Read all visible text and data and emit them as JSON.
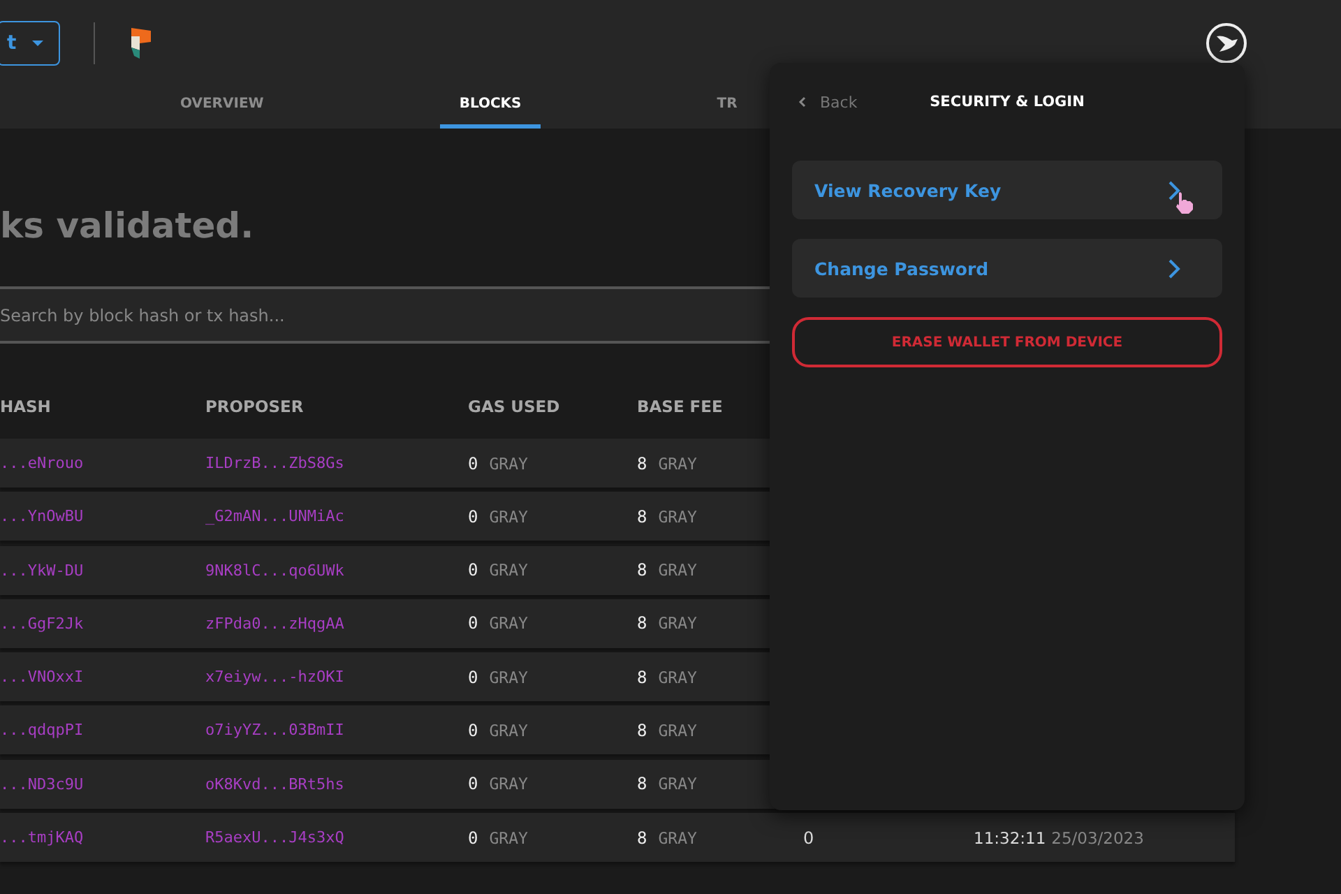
{
  "header": {
    "network_button": {
      "label": "t"
    },
    "tabs": [
      {
        "label": "OVERVIEW",
        "selected": false
      },
      {
        "label": "BLOCKS",
        "selected": true
      },
      {
        "label": "TR",
        "selected": false
      }
    ]
  },
  "heading": "ks validated.",
  "search": {
    "placeholder": "Search by block hash or tx hash..."
  },
  "table": {
    "columns": [
      "HASH",
      "PROPOSER",
      "GAS USED",
      "BASE FEE"
    ],
    "rows": [
      {
        "hash": "...eNrouo",
        "proposer": "ILDrzB...ZbS8Gs",
        "gas_used": "0",
        "gas_unit": "GRAY",
        "base_fee": "8",
        "fee_unit": "GRAY"
      },
      {
        "hash": "...YnOwBU",
        "proposer": "_G2mAN...UNMiAc",
        "gas_used": "0",
        "gas_unit": "GRAY",
        "base_fee": "8",
        "fee_unit": "GRAY"
      },
      {
        "hash": "...YkW-DU",
        "proposer": "9NK8lC...qo6UWk",
        "gas_used": "0",
        "gas_unit": "GRAY",
        "base_fee": "8",
        "fee_unit": "GRAY"
      },
      {
        "hash": "...GgF2Jk",
        "proposer": "zFPda0...zHqgAA",
        "gas_used": "0",
        "gas_unit": "GRAY",
        "base_fee": "8",
        "fee_unit": "GRAY"
      },
      {
        "hash": "...VNOxxI",
        "proposer": "x7eiyw...-hzOKI",
        "gas_used": "0",
        "gas_unit": "GRAY",
        "base_fee": "8",
        "fee_unit": "GRAY"
      },
      {
        "hash": "...qdqpPI",
        "proposer": "o7iyYZ...03BmII",
        "gas_used": "0",
        "gas_unit": "GRAY",
        "base_fee": "8",
        "fee_unit": "GRAY"
      },
      {
        "hash": "...ND3c9U",
        "proposer": "oK8Kvd...BRt5hs",
        "gas_used": "0",
        "gas_unit": "GRAY",
        "base_fee": "8",
        "fee_unit": "GRAY"
      },
      {
        "hash": "...tmjKAQ",
        "proposer": "R5aexU...J4s3xQ",
        "gas_used": "0",
        "gas_unit": "GRAY",
        "base_fee": "8",
        "fee_unit": "GRAY",
        "txs": "0",
        "time": "11:32:11",
        "date": "25/03/2023"
      }
    ]
  },
  "panel": {
    "back": "Back",
    "title": "SECURITY & LOGIN",
    "items": [
      {
        "label": "View Recovery Key",
        "kind": "link",
        "hovered": true
      },
      {
        "label": "Change Password",
        "kind": "link",
        "hovered": false
      },
      {
        "label": "ERASE WALLET FROM DEVICE",
        "kind": "danger",
        "hovered": false
      }
    ]
  }
}
